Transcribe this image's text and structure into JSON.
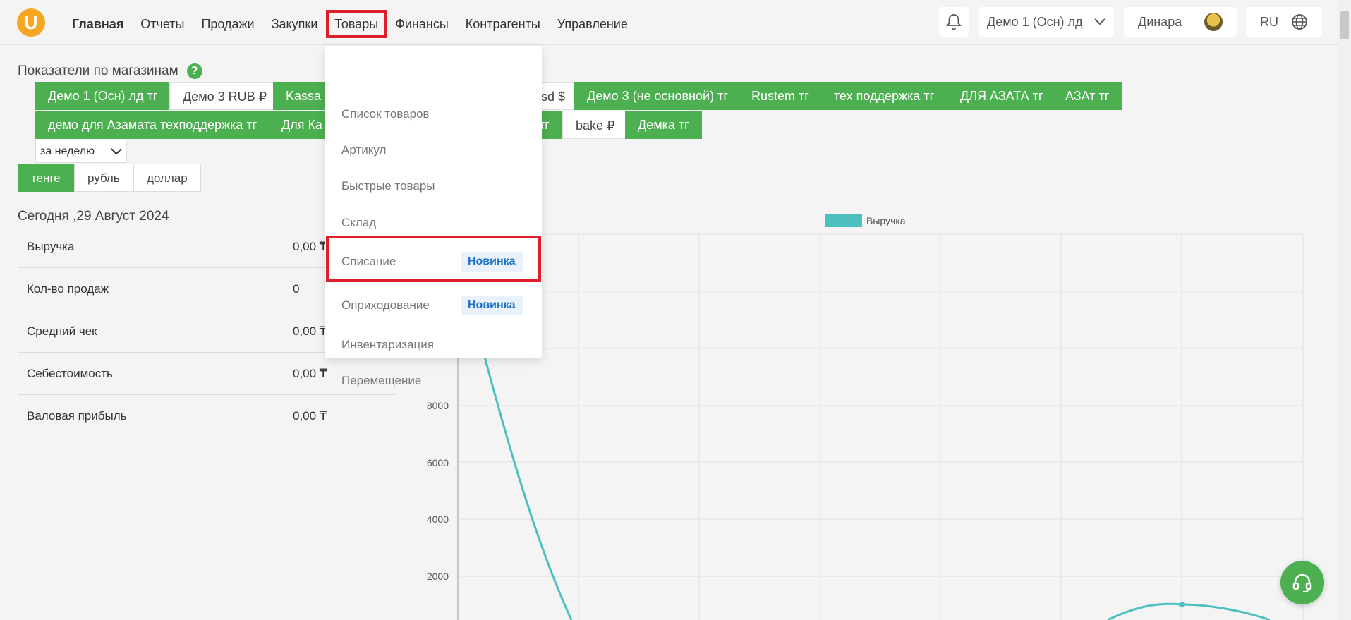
{
  "brand": {
    "logo_letter": "U",
    "color": "#f5a623"
  },
  "nav": [
    {
      "label": "Главная"
    },
    {
      "label": "Отчеты"
    },
    {
      "label": "Продажи"
    },
    {
      "label": "Закупки"
    },
    {
      "label": "Товары"
    },
    {
      "label": "Финансы"
    },
    {
      "label": "Контрагенты"
    },
    {
      "label": "Управление"
    }
  ],
  "header": {
    "store_select": "Демо 1 (Осн) лд",
    "user_name": "Динара",
    "language": "RU"
  },
  "section_title": "Показатели по магазинам",
  "stores_row1": [
    "Демо 1 (Осн) лд тг",
    "Демо 3 RUB ₽",
    "Kassa",
    "sd $",
    "Демо 3 (не основной) тг",
    "Rustem тг",
    "тех поддержка тг",
    "ДЛЯ АЗАТА тг",
    "АЗАт тг"
  ],
  "stores_row2": [
    "демо для Азамата техподдержка тг",
    "Для Ка",
    "тг",
    "bake ₽",
    "Демка тг"
  ],
  "period": "за неделю",
  "currencies": [
    "тенге",
    "рубль",
    "доллар"
  ],
  "date_title": "Сегодня ,29 Август 2024",
  "metrics": [
    {
      "label": "Выручка",
      "value": "0,00 ₸"
    },
    {
      "label": "Кол-во продаж",
      "value": "0"
    },
    {
      "label": "Средний чек",
      "value": "0,00 ₸"
    },
    {
      "label": "Себестоимость",
      "value": "0,00 ₸"
    },
    {
      "label": "Валовая прибыль",
      "value": "0,00 ₸"
    }
  ],
  "dropdown": {
    "items": [
      {
        "label": "Список товаров",
        "badge": ""
      },
      {
        "label": "Артикул",
        "badge": ""
      },
      {
        "label": "Быстрые товары",
        "badge": ""
      },
      {
        "label": "Склад",
        "badge": ""
      },
      {
        "label": "Списание",
        "badge": "Новинка"
      },
      {
        "label": "Оприходование",
        "badge": "Новинка"
      },
      {
        "label": "Инвентаризация",
        "badge": ""
      },
      {
        "label": "Перемещение",
        "badge": ""
      }
    ]
  },
  "chart_data": {
    "type": "line",
    "series": [
      {
        "name": "Выручка",
        "color": "#4cc0c0"
      }
    ],
    "ytick_labels": [
      "2000",
      "4000",
      "6000",
      "8000"
    ],
    "grid": true,
    "legend": "top"
  },
  "colors": {
    "green": "#4caf50",
    "highlight": "#e01d2a",
    "badge_text": "#1a73c8",
    "line": "#4cc0c0"
  }
}
